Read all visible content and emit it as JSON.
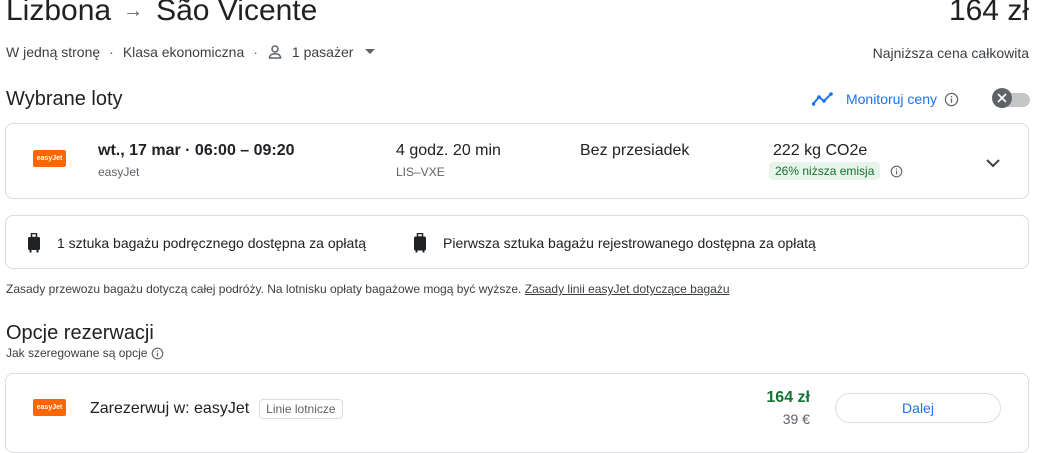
{
  "header": {
    "origin": "Lizbona",
    "destination": "São Vicente",
    "price": "164 zł",
    "trip_type": "W jedną stronę",
    "cabin_class": "Klasa ekonomiczna",
    "passengers": "1 pasażer",
    "price_note": "Najniższa cena całkowita"
  },
  "selected": {
    "title": "Wybrane loty",
    "track_prices": "Monitoruj ceny",
    "flight": {
      "date_time": "wt., 17 mar  ·  06:00 – 09:20",
      "airline": "easyJet",
      "logo_text": "easyJet",
      "duration": "4 godz. 20 min",
      "airports": "LIS–VXE",
      "stops": "Bez przesiadek",
      "emissions": "222 kg CO2e",
      "emissions_badge": "26% niższa emisja"
    }
  },
  "baggage": {
    "carry_on": "1 sztuka bagażu podręcznego dostępna za opłatą",
    "checked": "Pierwsza sztuka bagażu rejestrowanego dostępna za opłatą",
    "note": "Zasady przewozu bagażu dotyczą całej podróży. Na lotnisku opłaty bagażowe mogą być wyższe.",
    "link": "Zasady linii easyJet dotyczące bagażu"
  },
  "booking": {
    "title": "Opcje rezerwacji",
    "ranking_note": "Jak szeregowane są opcje",
    "option": {
      "label": "Zarezerwuj w: easyJet",
      "tag": "Linie lotnicze",
      "price": "164 zł",
      "price_alt": "39 €",
      "button": "Dalej"
    }
  },
  "colors": {
    "accent": "#1a73e8",
    "price_green": "#137333",
    "easyjet_orange": "#ff6600"
  }
}
